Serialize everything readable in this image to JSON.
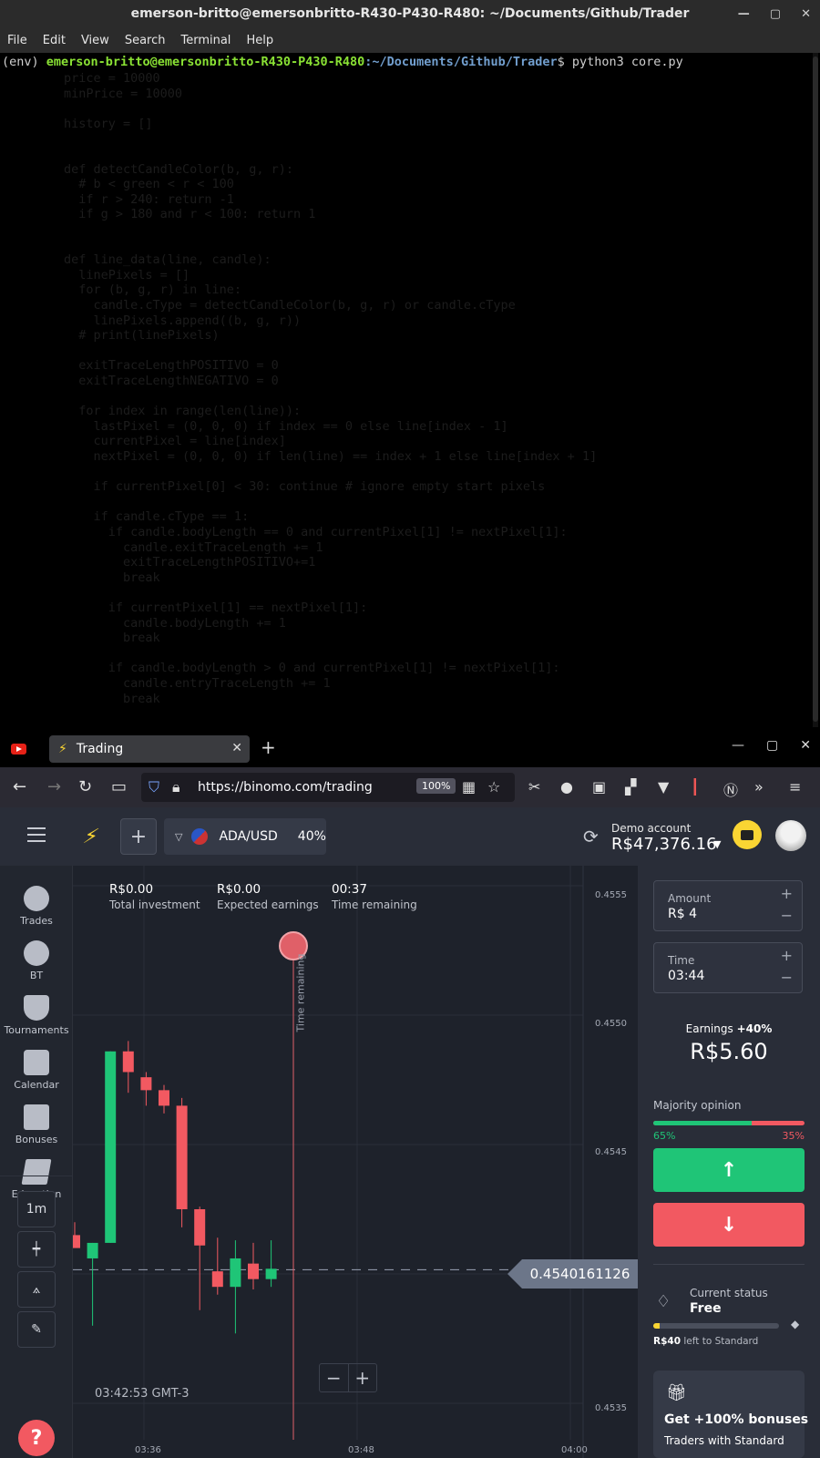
{
  "terminal": {
    "title": "emerson-britto@emersonbritto-R430-P430-R480: ~/Documents/Github/Trader",
    "menu": [
      "File",
      "Edit",
      "View",
      "Search",
      "Terminal",
      "Help"
    ],
    "prompt_env": "(env) ",
    "prompt_user": "emerson-britto@emersonbritto-R430-P430-R480",
    "prompt_path": ":~/Documents/Github/Trader",
    "prompt_cmd": "$ python3 core.py",
    "code_lines": [
      "price = 10000",
      "minPrice = 10000",
      "",
      "history = []",
      "",
      "",
      "def detectCandleColor(b, g, r):",
      "  # b < green < r < 100",
      "  if r > 240: return -1",
      "  if g > 180 and r < 100: return 1",
      "",
      "",
      "def line_data(line, candle):",
      "  linePixels = []",
      "  for (b, g, r) in line:",
      "    candle.cType = detectCandleColor(b, g, r) or candle.cType",
      "    linePixels.append((b, g, r))",
      "  # print(linePixels)",
      "",
      "  exitTraceLengthPOSITIVO = 0",
      "  exitTraceLengthNEGATIVO = 0",
      "",
      "  for index in range(len(line)):",
      "    lastPixel = (0, 0, 0) if index == 0 else line[index - 1]",
      "    currentPixel = line[index]",
      "    nextPixel = (0, 0, 0) if len(line) == index + 1 else line[index + 1]",
      "",
      "    if currentPixel[0] < 30: continue # ignore empty start pixels",
      "",
      "    if candle.cType == 1:",
      "      if candle.bodyLength == 0 and currentPixel[1] != nextPixel[1]:",
      "        candle.exitTraceLength += 1",
      "        exitTraceLengthPOSITIVO+=1",
      "        break",
      "",
      "      if currentPixel[1] == nextPixel[1]:",
      "        candle.bodyLength += 1",
      "        break",
      "",
      "      if candle.bodyLength > 0 and currentPixel[1] != nextPixel[1]:",
      "        candle.entryTraceLength += 1",
      "        break"
    ]
  },
  "browser": {
    "tab_title": "Trading",
    "url": "https://binomo.com/trading",
    "zoom": "100%"
  },
  "app": {
    "asset": {
      "name": "ADA/USD",
      "payout": "40%"
    },
    "account": {
      "label": "Demo account",
      "balance": "R$47,376.16"
    },
    "sidebar": [
      {
        "label": "Trades",
        "icon": "clock-icon"
      },
      {
        "label": "BT",
        "icon": "soccer-ball-icon"
      },
      {
        "label": "Tournaments",
        "icon": "trophy-icon"
      },
      {
        "label": "Calendar",
        "icon": "calendar-icon"
      },
      {
        "label": "Bonuses",
        "icon": "gift-icon"
      },
      {
        "label": "Education",
        "icon": "graduation-cap-icon"
      }
    ],
    "tools": {
      "timeframe": "1m"
    },
    "stats": [
      {
        "value": "R$0.00",
        "label": "Total investment"
      },
      {
        "value": "R$0.00",
        "label": "Expected earnings"
      },
      {
        "value": "00:37",
        "label": "Time remaining"
      }
    ],
    "chart_clock": "03:42:53 GMT-3",
    "timer_label": "Time remaining",
    "current_price": "0.4540161126",
    "panel": {
      "amount_label": "Amount",
      "amount_value": "R$ 4",
      "time_label": "Time",
      "time_value": "03:44",
      "earnings_label": "Earnings",
      "earnings_pct": "+40%",
      "earnings_value": "R$5.60",
      "majority_label": "Majority opinion",
      "majority_up": "65%",
      "majority_down": "35%",
      "majority_up_fraction": 0.65,
      "status_label": "Current status",
      "status_value": "Free",
      "status_progress_fraction": 0.05,
      "status_amount": "R$40",
      "status_note": " left to Standard",
      "bonus_title": "Get +100% bonuses",
      "bonus_sub": "Traders with Standard"
    }
  },
  "colors": {
    "up": "#1fc577",
    "down": "#f25961",
    "brand": "#fad533"
  },
  "chart_data": {
    "type": "candlestick",
    "y_ticks": [
      "0.4555",
      "0.4550",
      "0.4545",
      "0.4535"
    ],
    "x_ticks": [
      "03:36",
      "03:48",
      "04:00"
    ],
    "ylim": [
      0.4535,
      0.4555
    ],
    "current_price": 0.4540161126,
    "candles": [
      {
        "open": 0.45415,
        "high": 0.4542,
        "low": 0.45412,
        "close": 0.4541,
        "dir": "down"
      },
      {
        "open": 0.45406,
        "high": 0.45412,
        "low": 0.4538,
        "close": 0.45412,
        "dir": "up"
      },
      {
        "open": 0.45412,
        "high": 0.45486,
        "low": 0.45412,
        "close": 0.45486,
        "dir": "up"
      },
      {
        "open": 0.45486,
        "high": 0.4549,
        "low": 0.4547,
        "close": 0.45478,
        "dir": "down"
      },
      {
        "open": 0.45476,
        "high": 0.45478,
        "low": 0.45465,
        "close": 0.45471,
        "dir": "down"
      },
      {
        "open": 0.45471,
        "high": 0.45473,
        "low": 0.45462,
        "close": 0.45465,
        "dir": "down"
      },
      {
        "open": 0.45465,
        "high": 0.45468,
        "low": 0.45418,
        "close": 0.45425,
        "dir": "down"
      },
      {
        "open": 0.45425,
        "high": 0.45426,
        "low": 0.45386,
        "close": 0.45411,
        "dir": "down"
      },
      {
        "open": 0.45401,
        "high": 0.45414,
        "low": 0.45392,
        "close": 0.45395,
        "dir": "down"
      },
      {
        "open": 0.45395,
        "high": 0.45413,
        "low": 0.45377,
        "close": 0.45406,
        "dir": "up"
      },
      {
        "open": 0.45404,
        "high": 0.45412,
        "low": 0.45394,
        "close": 0.45398,
        "dir": "down"
      },
      {
        "open": 0.45398,
        "high": 0.45413,
        "low": 0.45395,
        "close": 0.45402,
        "dir": "up"
      }
    ]
  }
}
